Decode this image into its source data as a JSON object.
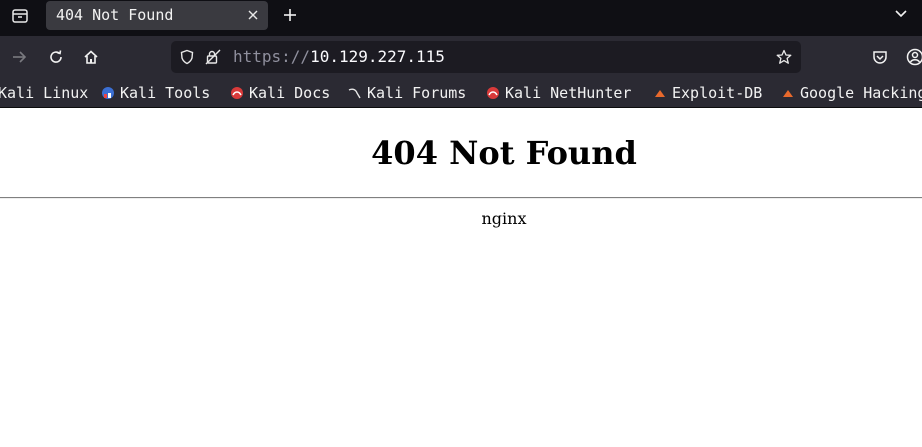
{
  "tab": {
    "title": "404 Not Found"
  },
  "navbar": {
    "url_scheme": "https://",
    "url_host": "10.129.227.115"
  },
  "bookmarks": [
    {
      "label": "Kali Linux",
      "icon": "kali-dragon-icon"
    },
    {
      "label": "Kali Tools",
      "icon": "kali-tools-icon"
    },
    {
      "label": "Kali Docs",
      "icon": "kali-docs-icon"
    },
    {
      "label": "Kali Forums",
      "icon": "kali-forums-icon"
    },
    {
      "label": "Kali NetHunter",
      "icon": "kali-nethunter-icon"
    },
    {
      "label": "Exploit-DB",
      "icon": "exploit-db-icon"
    },
    {
      "label": "Google Hacking DB",
      "icon": "ghdb-icon"
    }
  ],
  "page": {
    "heading": "404 Not Found",
    "server": "nginx"
  },
  "colors": {
    "tabbar_bg": "#0f0f14",
    "toolbar_bg": "#2b2a33",
    "urlbar_bg": "#1c1b22",
    "active_tab_bg": "#3a3a40"
  }
}
